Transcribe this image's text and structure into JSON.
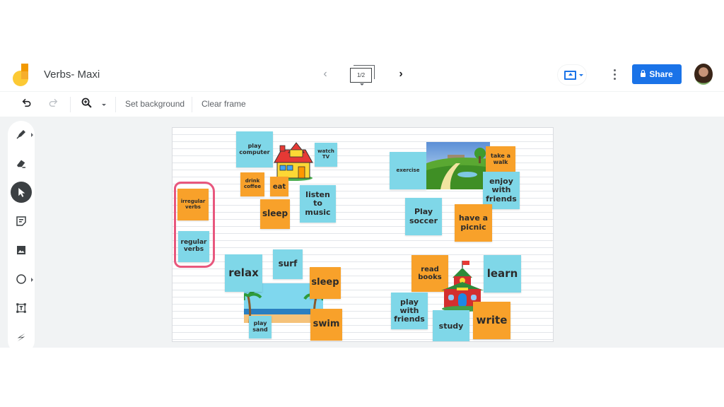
{
  "app": {
    "title": "Verbs- Maxi",
    "frame_indicator": "1/2",
    "share_label": "Share"
  },
  "toolbar": {
    "set_background": "Set background",
    "clear_frame": "Clear frame"
  },
  "tools": [
    "pen",
    "eraser",
    "select",
    "sticky-note",
    "image",
    "circle",
    "text-box",
    "laser"
  ],
  "active_tool": "select",
  "colors": {
    "accent": "#1a73e8",
    "note_blue": "#7fd7e8",
    "note_orange": "#f8a12a",
    "bracket_pink": "#e8577d"
  },
  "canvas": {
    "legend": {
      "irregular": "irregular verbs",
      "regular": "regular verbs"
    },
    "home": {
      "notes": [
        "play computer",
        "watch TV",
        "drink coffee",
        "eat",
        "listen to music",
        "sleep"
      ]
    },
    "park": {
      "notes": [
        "exercise",
        "take a walk",
        "enjoy with friends",
        "Play soccer",
        "have a picnic"
      ]
    },
    "beach": {
      "notes": [
        "relax",
        "surf",
        "sleep",
        "play sand",
        "swim"
      ]
    },
    "school": {
      "notes": [
        "read books",
        "learn",
        "play with friends",
        "study",
        "write"
      ]
    }
  }
}
